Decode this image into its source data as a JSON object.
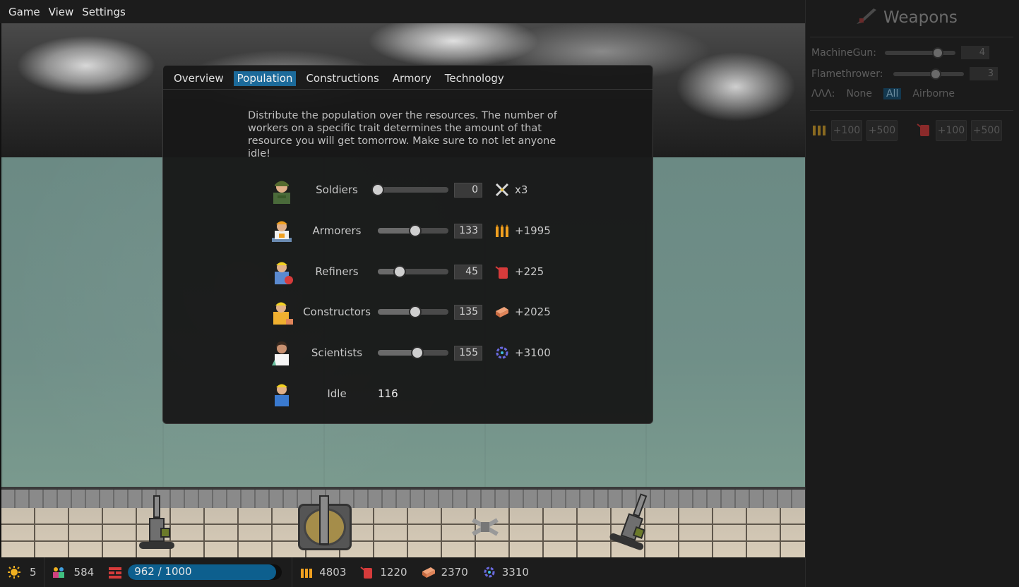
{
  "menu": {
    "items": [
      "Game",
      "View",
      "Settings"
    ]
  },
  "modal": {
    "tabs": [
      "Overview",
      "Population",
      "Constructions",
      "Armory",
      "Technology"
    ],
    "active_tab": "Population",
    "description": "Distribute the population over the resources. The number of workers on a specific trait determines the amount of that resource you will get tomorrow. Make sure to not let anyone idle!",
    "rows": [
      {
        "label": "Soldiers",
        "value": "0",
        "fraction": 0.0,
        "result": "x3",
        "icon": "swords-icon"
      },
      {
        "label": "Armorers",
        "value": "133",
        "fraction": 0.53,
        "result": "+1995",
        "icon": "ammo-icon"
      },
      {
        "label": "Refiners",
        "value": "45",
        "fraction": 0.31,
        "result": "+225",
        "icon": "fuel-can-icon"
      },
      {
        "label": "Constructors",
        "value": "135",
        "fraction": 0.53,
        "result": "+2025",
        "icon": "brick-icon"
      },
      {
        "label": "Scientists",
        "value": "155",
        "fraction": 0.56,
        "result": "+3100",
        "icon": "research-icon"
      }
    ],
    "idle": {
      "label": "Idle",
      "value": "116"
    }
  },
  "right_panel": {
    "title": "Weapons",
    "weapons": [
      {
        "label": "MachineGun:",
        "value": "4",
        "fraction": 0.75
      },
      {
        "label": "Flamethrower:",
        "value": "3",
        "fraction": 0.6
      }
    ],
    "target_label": "ΛΛΛ:",
    "target_options": [
      "None",
      "All",
      "Airborne"
    ],
    "target_selected": "All",
    "ammo_buttons": [
      "+100",
      "+500"
    ],
    "fuel_buttons": [
      "+100",
      "+500"
    ]
  },
  "bottom_bar": {
    "days": "5",
    "population": "584",
    "wall_hp": "962 / 1000",
    "wall_fraction": 0.962,
    "ammo": "4803",
    "fuel": "1220",
    "bricks": "2370",
    "research": "3310"
  },
  "colors": {
    "accent": "#1c6a9a",
    "progress": "#0d5f8e",
    "ammo": "#f0a020",
    "fuel": "#d63b3b",
    "brick": "#e0855a",
    "research": "#6a6ae0"
  }
}
